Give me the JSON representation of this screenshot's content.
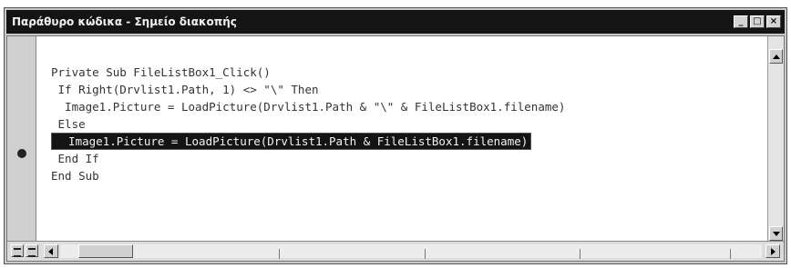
{
  "window": {
    "title": "Παράθυρο κώδικα - Σημείο διακοπής",
    "buttons": {
      "minimize": "_",
      "maximize": "□",
      "close": "×"
    }
  },
  "code": {
    "lines": [
      "Private Sub FileListBox1_Click()",
      " If Right(Drvlist1.Path, 1) <> \"\\\" Then",
      "  Image1.Picture = LoadPicture(Drvlist1.Path & \"\\\" & FileListBox1.filename)",
      " Else",
      "  Image1.Picture = LoadPicture(Drvlist1.Path & FileListBox1.filename)",
      " End If",
      "End Sub"
    ],
    "highlighted_line_index": 4,
    "breakpoint_line_index": 4
  },
  "icons": {
    "breakpoint": "breakpoint-dot-icon",
    "procedure_view": "procedure-view-icon",
    "full_module_view": "full-module-view-icon"
  }
}
